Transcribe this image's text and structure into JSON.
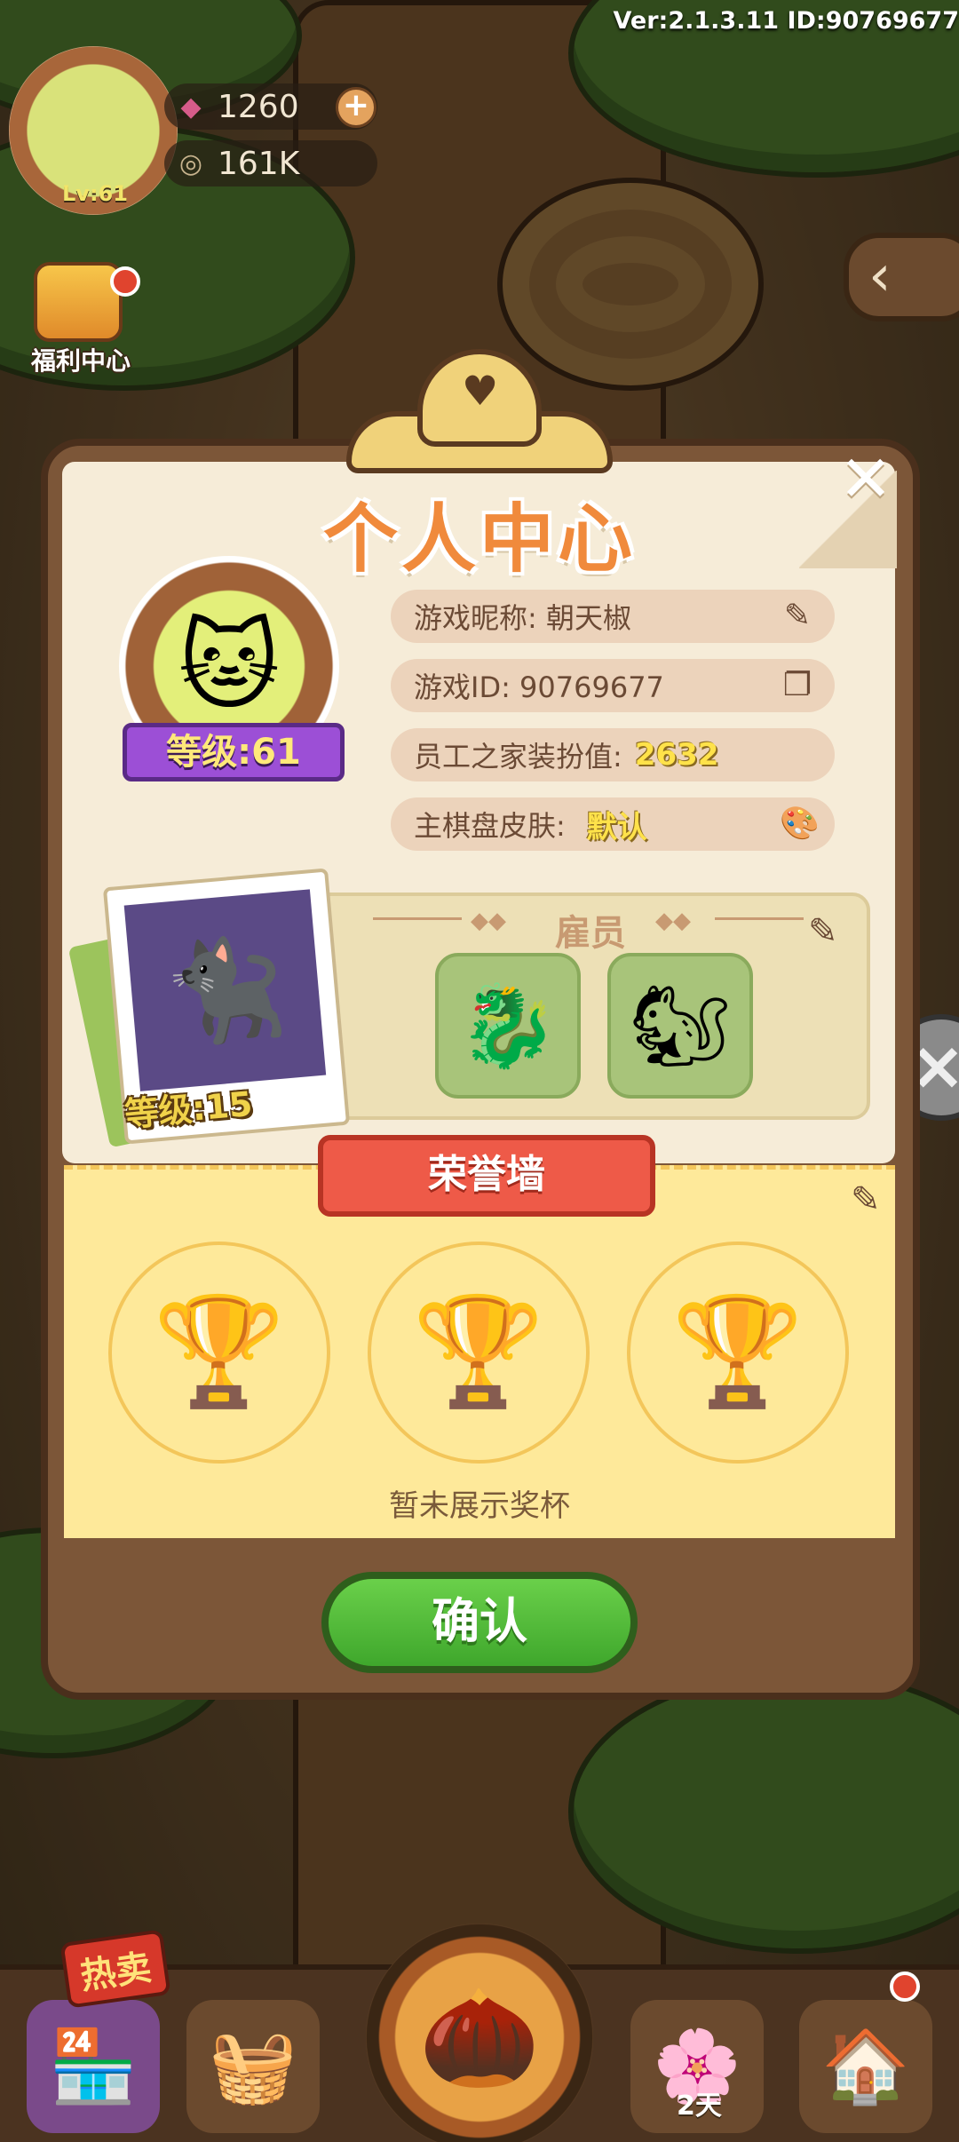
{
  "hud": {
    "version": "Ver:2.1.3.11 ID:90769677",
    "player_level": "Lv:61",
    "gems": "1260",
    "seeds": "161K",
    "welfare_label": "福利中心"
  },
  "modal": {
    "title": "个人中心",
    "level_badge": "等级:61",
    "nickname_label": "游戏昵称: 朝天椒",
    "game_id_label": "游戏ID: 90769677",
    "decor_label": "员工之家装扮值:",
    "decor_value": "2632",
    "board_skin_label": "主棋盘皮肤:",
    "board_skin_value": "默认",
    "employees_title": "雇员",
    "pet_level": "等级:15",
    "honor_title": "荣誉墙",
    "honor_empty": "暂未展示奖杯",
    "confirm_label": "确认"
  },
  "bottom_nav": {
    "hot_tag": "热卖",
    "days_label": "2天"
  },
  "icons": {
    "gem": "gem-icon",
    "seed": "seed-icon",
    "edit": "pencil-icon",
    "copy": "copy-icon",
    "palette": "palette-icon",
    "trophy": "trophy-icon",
    "close": "close-icon"
  },
  "colors": {
    "confirm_green": "#4cb830",
    "honor_red": "#ee5a48",
    "level_purple": "#9c4fd6",
    "panel_brown": "#7c5638"
  }
}
